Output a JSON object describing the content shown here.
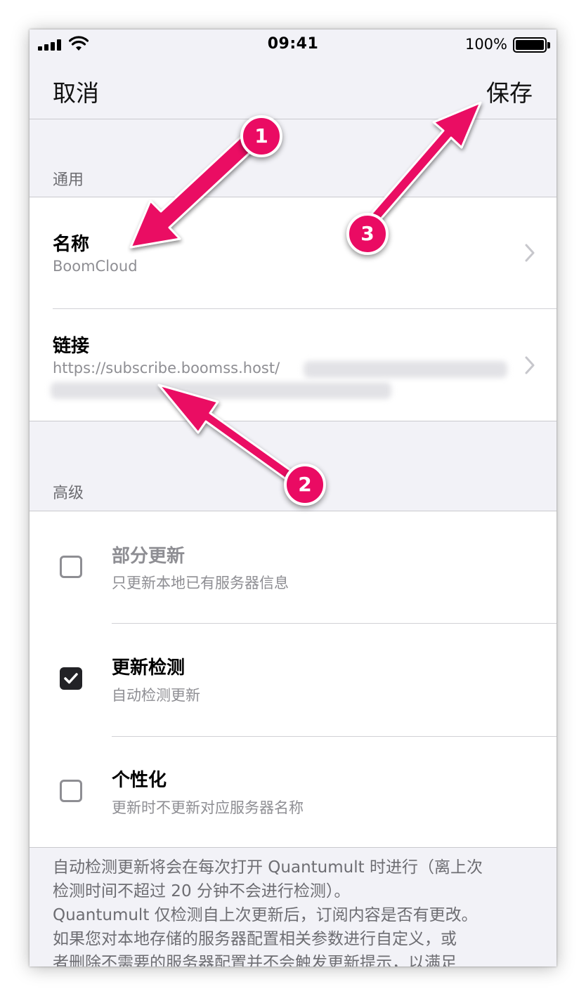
{
  "status_bar": {
    "time": "09:41",
    "battery": "100%",
    "icons": [
      "signal-icon",
      "wifi-icon",
      "battery-icon"
    ]
  },
  "nav": {
    "cancel": "取消",
    "save": "保存"
  },
  "general": {
    "header": "通用",
    "name": {
      "title": "名称",
      "value": "BoomCloud"
    },
    "link": {
      "title": "链接",
      "value": "https://subscribe.boomss.host/"
    }
  },
  "advanced": {
    "header": "高级",
    "options": [
      {
        "title": "部分更新",
        "subtitle": "只更新本地已有服务器信息",
        "checked": false
      },
      {
        "title": "更新检测",
        "subtitle": "自动检测更新",
        "checked": true
      },
      {
        "title": "个性化",
        "subtitle": "更新时不更新对应服务器名称",
        "checked": false
      }
    ]
  },
  "footer": {
    "lines": [
      "自动检测更新将会在每次打开 Quantumult 时进行（离上次",
      "检测时间不超过 20 分钟不会进行检测）。",
      "Quantumult 仅检测自上次更新后，订阅内容是否有更改。",
      "如果您对本地存储的服务器配置相关参数进行自定义，或",
      "者删除不需要的服务器配置并不会触发更新提示，以满足"
    ]
  },
  "annotations": {
    "markers": [
      "1",
      "2",
      "3"
    ],
    "color": "#ea0b63"
  },
  "colors": {
    "background": "#f2f2f7",
    "cell": "#ffffff",
    "secondary_text": "#8e8e93",
    "checkbox_checked": "#222226"
  }
}
